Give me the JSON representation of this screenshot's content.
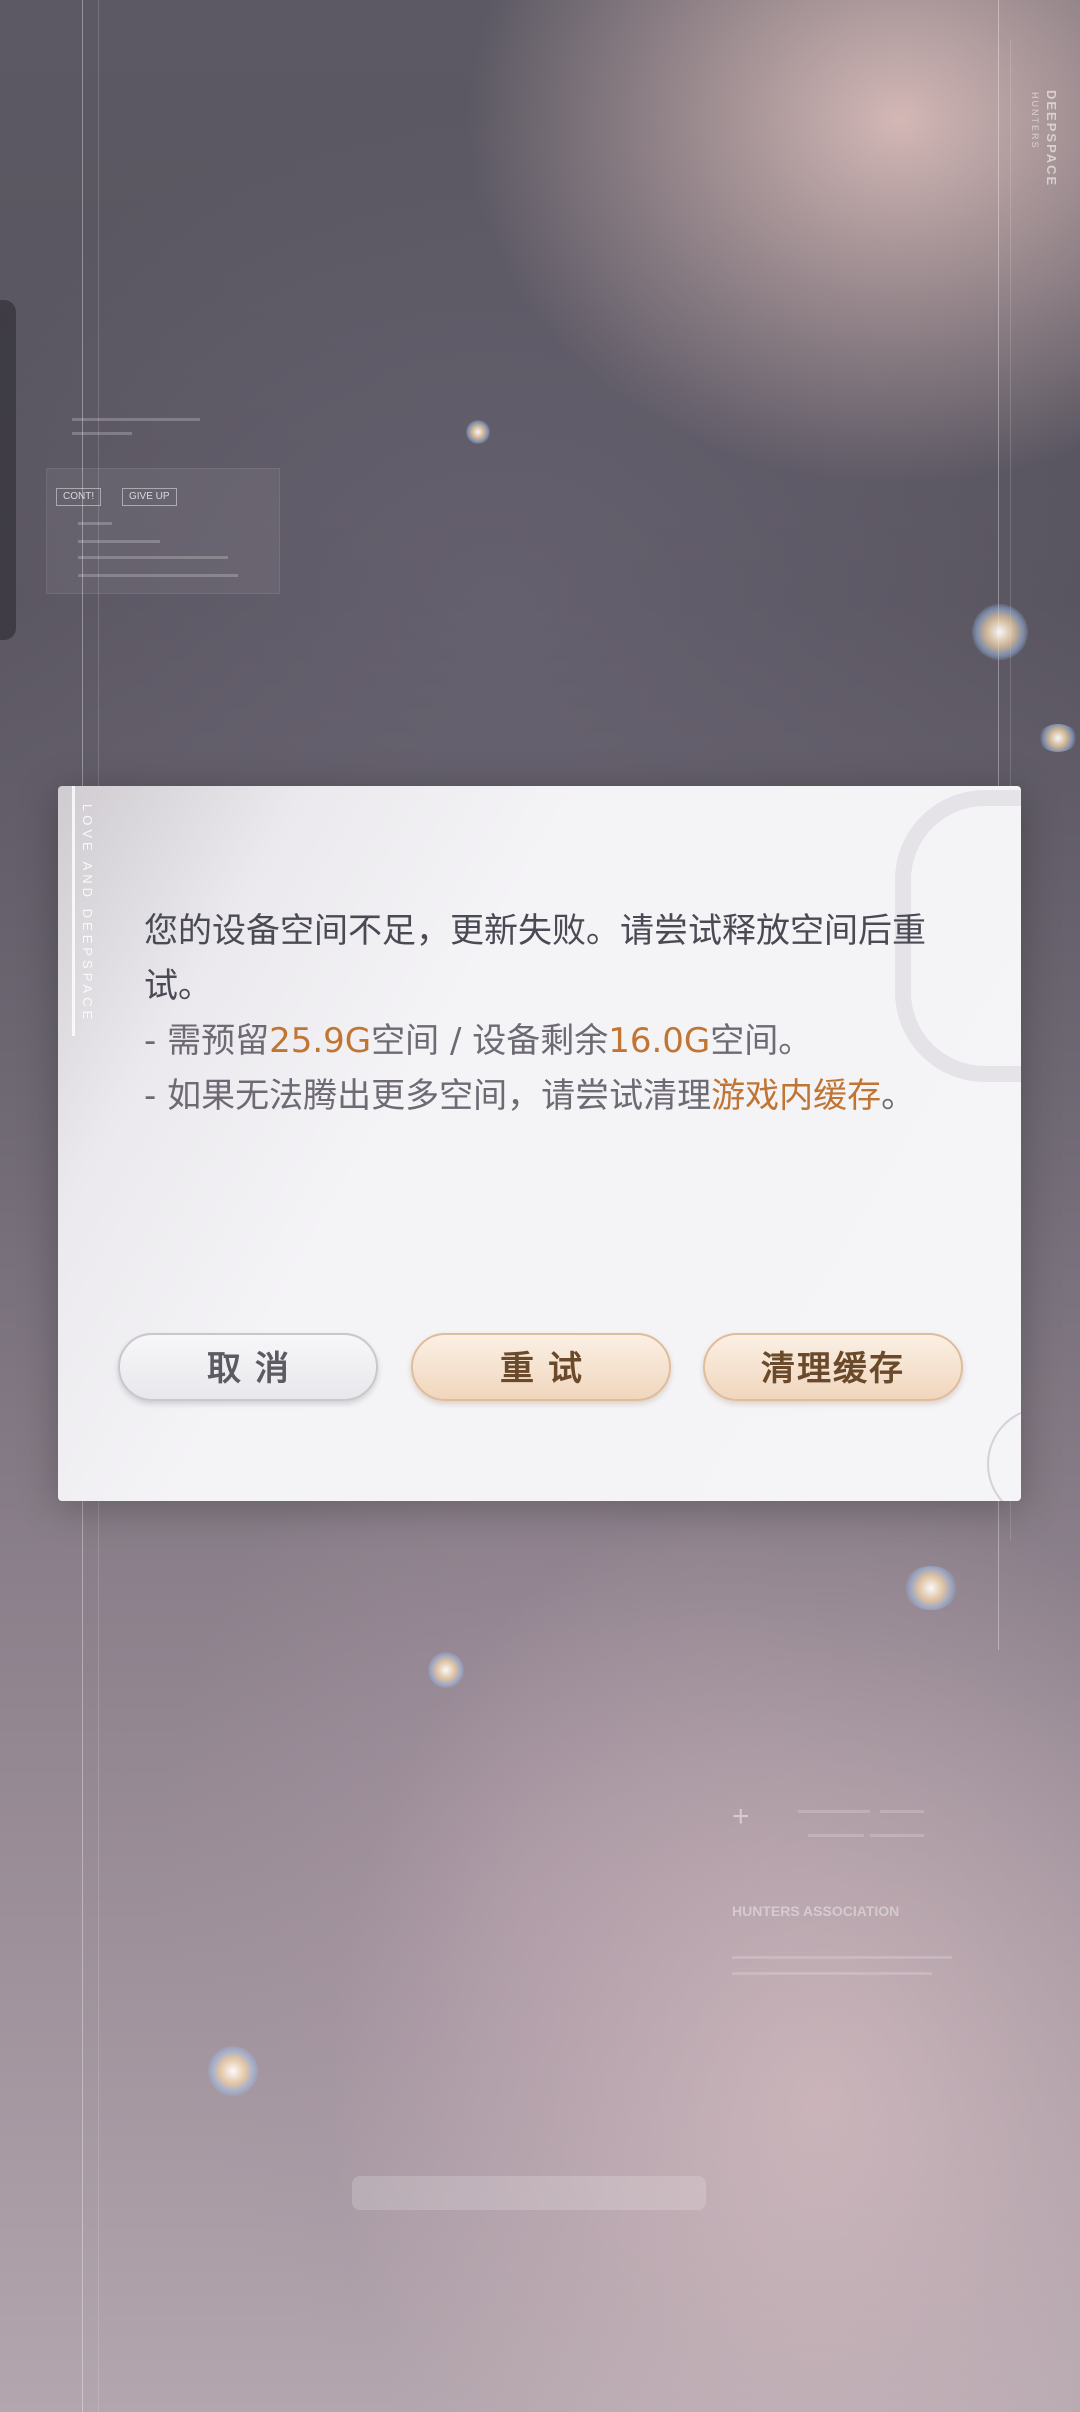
{
  "background": {
    "brand_vertical": "DEEPSPACE",
    "brand_vertical_sub": "HUNTERS",
    "deco_tags": [
      "CONT!",
      "GIVE UP"
    ],
    "association_label": "HUNTERS ASSOCIATION"
  },
  "dialog": {
    "side_label": "LOVE AND DEEPSPACE",
    "message": {
      "line1": "您的设备空间不足，更新失败。请尝试释放空间后重试。",
      "line2_prefix": "- 需预留",
      "required_space": "25.9G",
      "line2_middle": "空间 / 设备剩余",
      "remaining_space": "16.0G",
      "line2_suffix": "空间。",
      "line3_prefix": "- 如果无法腾出更多空间，请尝试清理",
      "line3_link": "游戏内缓存",
      "line3_suffix": "。"
    },
    "buttons": {
      "cancel": "取消",
      "retry": "重试",
      "clear_cache": "清理缓存"
    }
  },
  "colors": {
    "highlight": "#c07533",
    "text": "#4a4a55",
    "button_primary_bg": "#f0d6bd"
  }
}
